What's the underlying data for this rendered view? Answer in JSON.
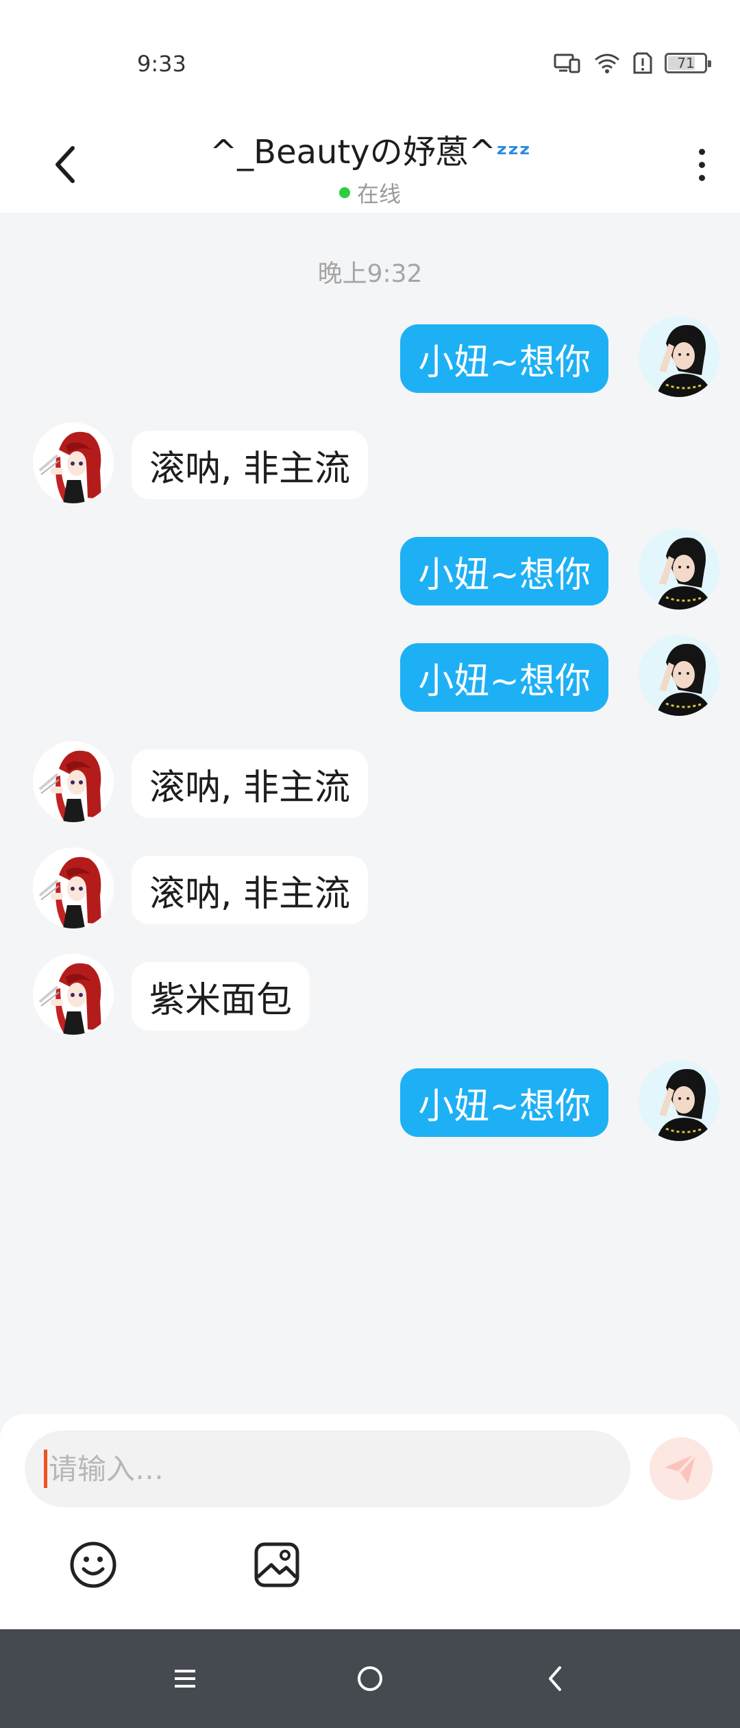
{
  "status_bar": {
    "time": "9:33",
    "battery": "71"
  },
  "header": {
    "title": "^_Beautyの妤蒽^",
    "title_emoji": "ᶻᶻᶻ",
    "status": "在线"
  },
  "chat": {
    "timestamp": "晚上9:32",
    "messages": [
      {
        "from": "me",
        "text": "小妞~想你"
      },
      {
        "from": "other",
        "text": "滚呐, 非主流"
      },
      {
        "from": "me",
        "text": "小妞~想你"
      },
      {
        "from": "me",
        "text": "小妞~想你"
      },
      {
        "from": "other",
        "text": "滚呐, 非主流"
      },
      {
        "from": "other",
        "text": "滚呐, 非主流"
      },
      {
        "from": "other",
        "text": "紫米面包"
      },
      {
        "from": "me",
        "text": "小妞~想你"
      }
    ]
  },
  "composer": {
    "placeholder": "请输入…",
    "value": ""
  },
  "icons": {
    "back": "chevron-left-icon",
    "more": "more-vertical-icon",
    "send": "send-icon",
    "emoji": "emoji-icon",
    "image": "image-icon",
    "nav_menu": "menu-icon",
    "nav_home": "home-circle-icon",
    "nav_back": "nav-back-icon"
  },
  "colors": {
    "my_bubble": "#1eb0f5",
    "other_bubble": "#ffffff",
    "background": "#f4f5f7",
    "online": "#2ecc40",
    "send_button": "#fde7e3",
    "caret": "#f0521e"
  }
}
